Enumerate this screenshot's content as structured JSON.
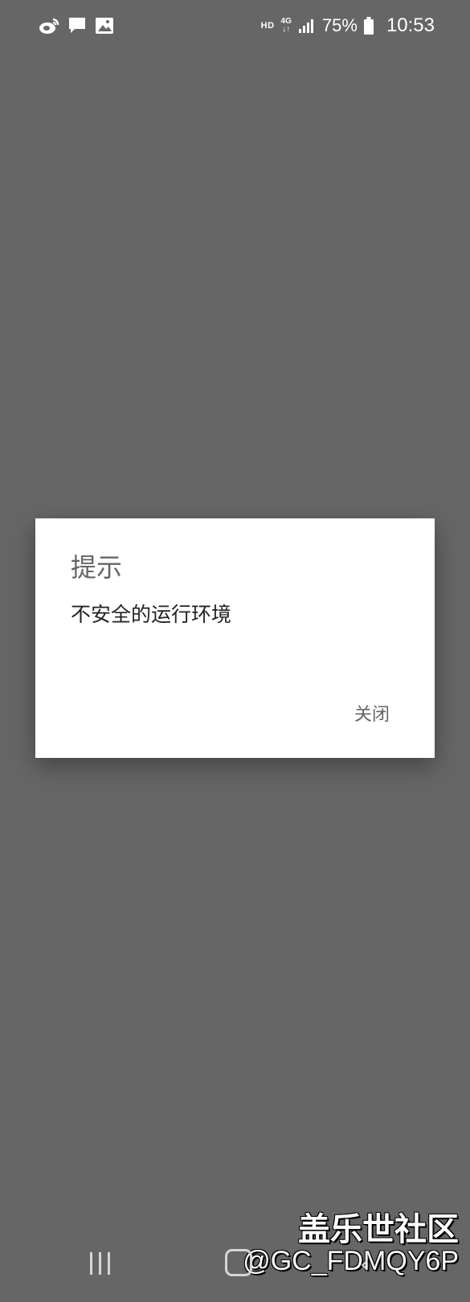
{
  "status_bar": {
    "left_icons": [
      "weibo-icon",
      "message-icon",
      "gallery-icon"
    ],
    "hd_label": "HD",
    "network_label": "4G",
    "network_arrows": "↓↑",
    "battery_percent": "75%",
    "time": "10:53"
  },
  "dialog": {
    "title": "提示",
    "message": "不安全的运行环境",
    "close_label": "关闭"
  },
  "watermark": {
    "title": "盖乐世社区",
    "user": "@GC_FDMQY6P"
  },
  "nav": {
    "icons": [
      "recents-icon",
      "home-icon",
      "back-icon"
    ]
  },
  "colors": {
    "scrim": "#666666",
    "dialog_bg": "#ffffff",
    "title_text": "#666666",
    "message_text": "#222222",
    "button_text": "#666666"
  }
}
